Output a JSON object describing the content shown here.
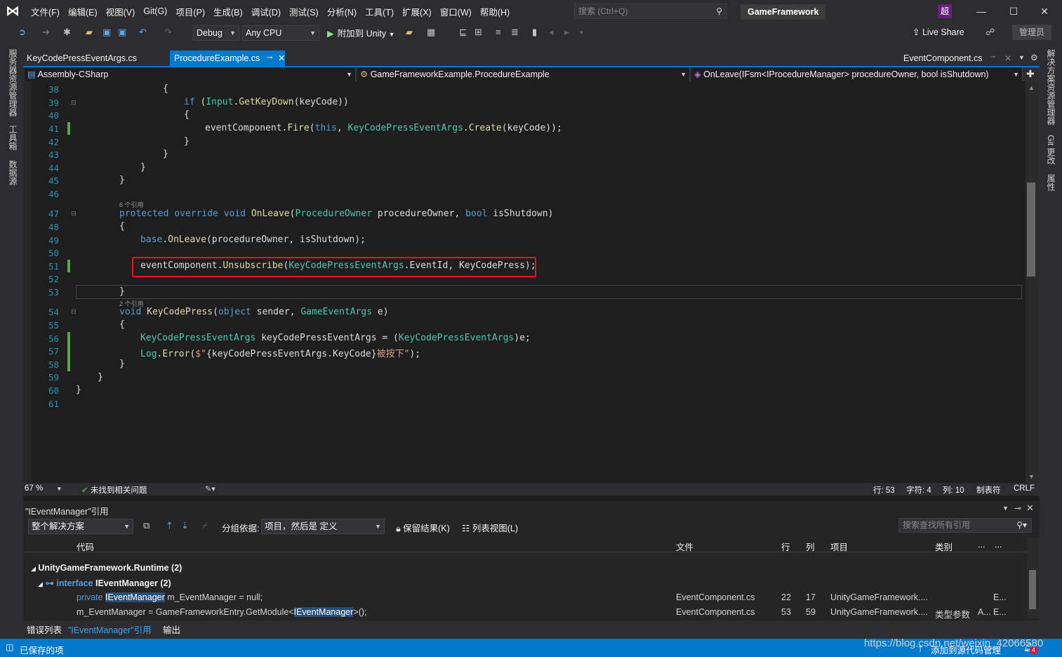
{
  "menu": [
    "文件(F)",
    "编辑(E)",
    "视图(V)",
    "Git(G)",
    "项目(P)",
    "生成(B)",
    "调试(D)",
    "测试(S)",
    "分析(N)",
    "工具(T)",
    "扩展(X)",
    "窗口(W)",
    "帮助(H)"
  ],
  "search": {
    "placeholder": "搜索 (Ctrl+Q)"
  },
  "solution_name": "GameFramework",
  "avatar": "超",
  "toolbar": {
    "config": "Debug",
    "platform": "Any CPU",
    "attach": "附加到 Unity",
    "live_share": "Live Share",
    "admin": "管理员"
  },
  "left_strip": [
    "服务器资源管理器",
    "工具箱",
    "数据源"
  ],
  "right_strip": [
    "解决方案资源管理器",
    "Git 更改",
    "属性"
  ],
  "tabs": {
    "tab1": "KeyCodePressEventArgs.cs",
    "tab2": "ProcedureExample.cs",
    "tab3": "EventComponent.cs"
  },
  "nav": {
    "project": "Assembly-CSharp",
    "class": "GameFrameworkExample.ProcedureExample",
    "member": "OnLeave(IFsm<IProcedureManager> procedureOwner, bool isShutdown)"
  },
  "code": {
    "line_numbers": [
      "38",
      "39",
      "40",
      "41",
      "42",
      "43",
      "44",
      "45",
      "46",
      "47",
      "48",
      "49",
      "50",
      "51",
      "52",
      "53",
      "54",
      "55",
      "56",
      "57",
      "58",
      "59",
      "60",
      "61"
    ],
    "codelens1": "6 个引用",
    "codelens2": "2 个引用"
  },
  "editor_status": {
    "zoom": "67 %",
    "issues": "未找到相关问题",
    "line": "行: 53",
    "char": "字符: 4",
    "col": "列: 10",
    "tabs": "制表符",
    "eol": "CRLF"
  },
  "refs": {
    "title": "\"IEventManager\"引用",
    "scope": "整个解决方案",
    "group_by_label": "分组依据:",
    "group_by_value": "项目，然后是 定义",
    "keep_results": "保留结果(K)",
    "list_view": "列表视图(L)",
    "search_placeholder": "搜索查找所有引用",
    "columns": [
      "代码",
      "文件",
      "行",
      "列",
      "项目",
      "类别",
      "...",
      "..."
    ],
    "group1": "UnityGameFramework.Runtime  (2)",
    "group2_kw": "interface",
    "group2": "IEventManager  (2)",
    "rows": [
      {
        "code_pre": "private ",
        "code_hl": "IEventManager",
        "code_post": " m_EventManager = null;",
        "file": "EventComponent.cs",
        "line": "22",
        "col": "17",
        "project": "UnityGameFramework....",
        "kind": "",
        "a": "",
        "b": "E..."
      },
      {
        "code_pre": "m_EventManager = GameFrameworkEntry.GetModule<",
        "code_hl": "IEventManager",
        "code_post": ">();",
        "file": "EventComponent.cs",
        "line": "53",
        "col": "59",
        "project": "UnityGameFramework....",
        "kind": "类型参数",
        "a": "A...",
        "b": "E..."
      }
    ]
  },
  "bottom_tabs": [
    "错误列表",
    "\"IEventManager\"引用",
    "输出"
  ],
  "status": {
    "saved": "已保存的项",
    "source_control": "添加到源代码管理",
    "watermark": "https://blog.csdn.net/weixin_42066580",
    "badge": "4"
  }
}
